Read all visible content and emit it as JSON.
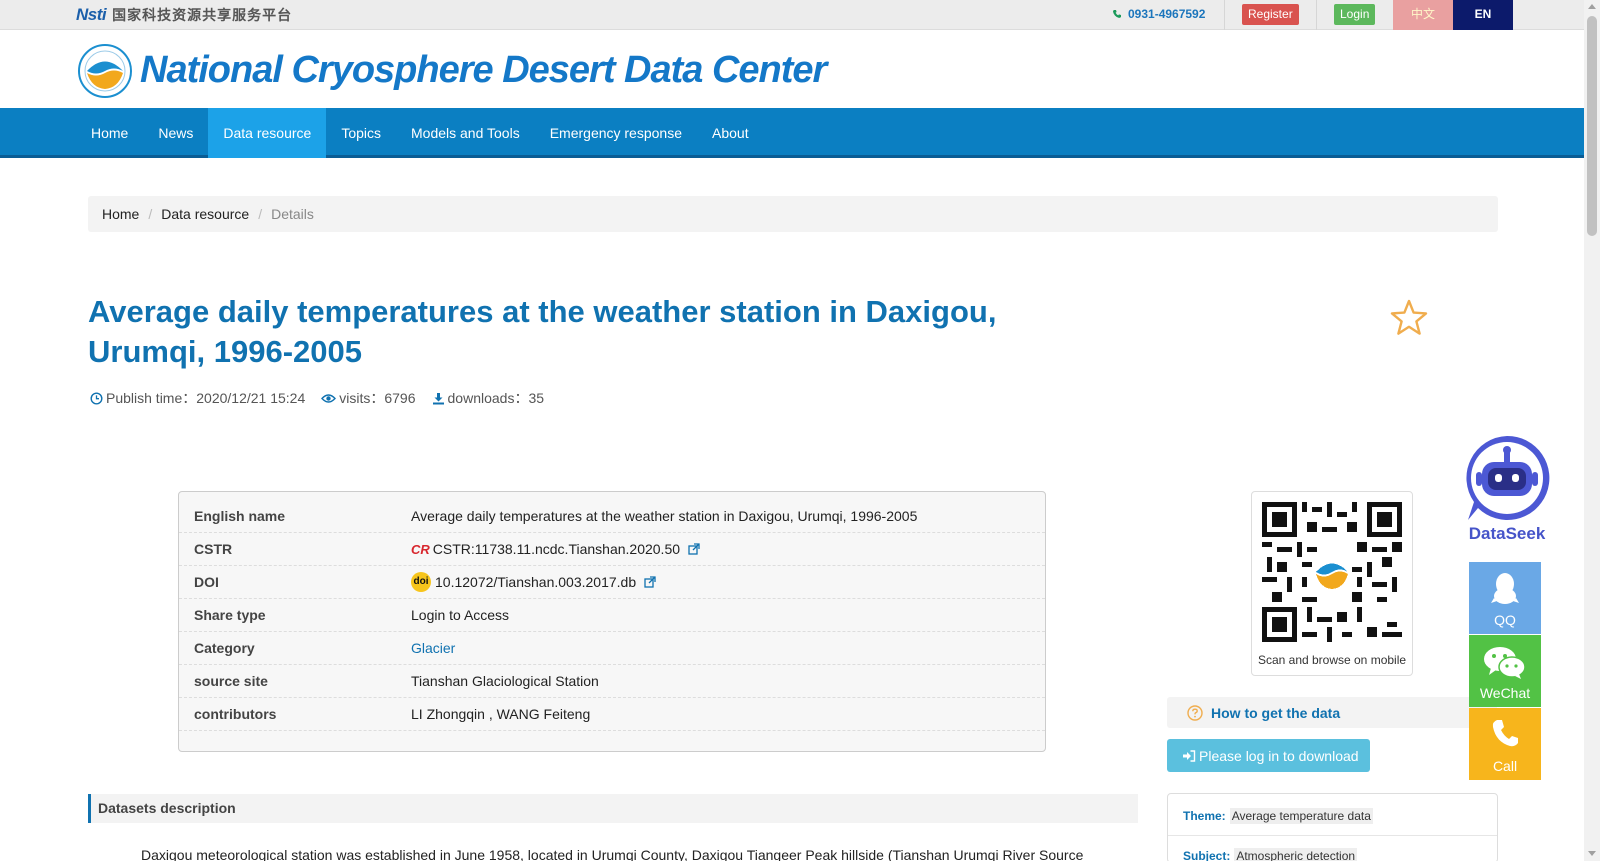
{
  "topbar": {
    "nsti_mark": "Nsti",
    "platform_name": "国家科技资源共享服务平台",
    "phone": "0931-4967592",
    "register_label": "Register",
    "login_label": "Login",
    "lang_zh": "中文",
    "lang_en": "EN"
  },
  "header": {
    "site_title": "National Cryosphere Desert Data Center"
  },
  "nav": {
    "items": [
      {
        "label": "Home"
      },
      {
        "label": "News"
      },
      {
        "label": "Data resource",
        "active": true
      },
      {
        "label": "Topics"
      },
      {
        "label": "Models and Tools"
      },
      {
        "label": "Emergency response"
      },
      {
        "label": "About"
      }
    ]
  },
  "breadcrumb": {
    "home": "Home",
    "section": "Data resource",
    "current": "Details",
    "separator": "/"
  },
  "dataset": {
    "title": "Average daily temperatures at the weather station in Daxigou, Urumqi, 1996-2005",
    "publish_label": "Publish time：2020/12/21 15:24",
    "visits_label": "visits：6796",
    "downloads_label": "downloads：35"
  },
  "info": {
    "rows": [
      {
        "key": "English name",
        "value": "Average daily temperatures at the weather station in Daxigou, Urumqi, 1996-2005"
      },
      {
        "key": "CSTR",
        "value": "CSTR:11738.11.ncdc.Tianshan.2020.50"
      },
      {
        "key": "DOI",
        "value": "10.12072/Tianshan.003.2017.db"
      },
      {
        "key": "Share type",
        "value": "Login to Access"
      },
      {
        "key": "Category",
        "value": "Glacier"
      },
      {
        "key": "source site",
        "value": "Tianshan Glaciological Station"
      },
      {
        "key": "contributors",
        "value": "LI Zhongqin , WANG Feiteng"
      }
    ],
    "cstr_badge": "CR",
    "doi_badge": "doi"
  },
  "sidebar": {
    "qr_caption": "Scan and browse on mobile",
    "howto_label": "How to get the data",
    "download_label": "Please log in to download",
    "theme_key": "Theme:",
    "theme_value": "Average temperature data",
    "subject_key": "Subject:",
    "subject_value": "Atmospheric detection"
  },
  "description": {
    "heading": "Datasets description",
    "text": "Daxigou meteorological station was established in June 1958, located in Urumqi County, Daxigou Tiangeer Peak hillside (Tianshan Urumqi River Source"
  },
  "floating": {
    "dataseek_label": "DataSeek",
    "qq_label": "QQ",
    "wechat_label": "WeChat",
    "call_label": "Call"
  },
  "colors": {
    "brand_blue": "#1072b0",
    "nav_blue": "#0b7fc2",
    "nav_active": "#1ca2e8",
    "register_red": "#d9534f",
    "login_green": "#5cb85c",
    "star_orange": "#f0ad4e"
  }
}
